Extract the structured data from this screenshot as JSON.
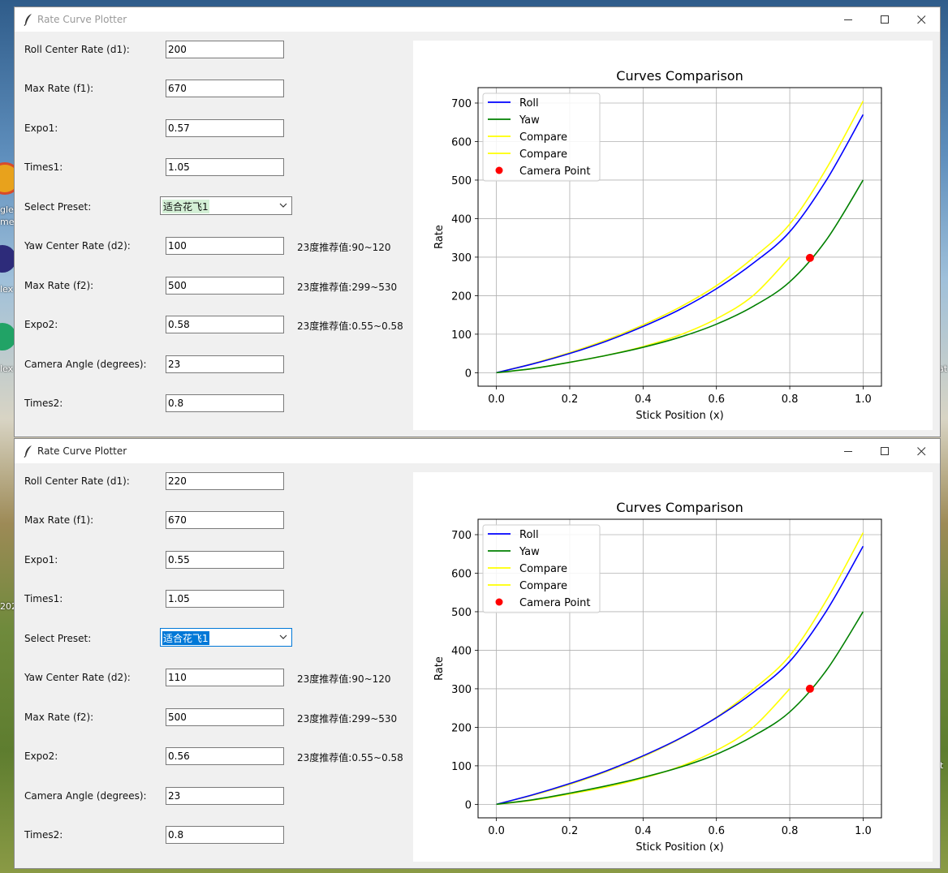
{
  "desktop": {
    "labels": [
      "gle",
      "me",
      "lex",
      "lex",
      "202",
      "at",
      "t"
    ]
  },
  "windows": [
    {
      "title": "Rate Curve Plotter",
      "fields": [
        {
          "label": "Roll Center Rate (d1):",
          "value": "200"
        },
        {
          "label": "Max Rate (f1):",
          "value": "670"
        },
        {
          "label": "Expo1:",
          "value": "0.57"
        },
        {
          "label": "Times1:",
          "value": "1.05"
        },
        {
          "label": "Select Preset:",
          "value": "适合花飞1"
        },
        {
          "label": "Yaw Center Rate (d2):",
          "value": "100",
          "hint": "23度推荐值:90~120"
        },
        {
          "label": "Max Rate (f2):",
          "value": "500",
          "hint": "23度推荐值:299~530"
        },
        {
          "label": "Expo2:",
          "value": "0.58",
          "hint": "23度推荐值:0.55~0.58"
        },
        {
          "label": "Camera Angle (degrees):",
          "value": "23"
        },
        {
          "label": "Times2:",
          "value": "0.8"
        }
      ],
      "chart_data": {
        "type": "line",
        "title": "Curves Comparison",
        "xlabel": "Stick Position (x)",
        "ylabel": "Rate",
        "xlim": [
          -0.05,
          1.05
        ],
        "ylim": [
          -35,
          740
        ],
        "xticks": [
          "0.0",
          "0.2",
          "0.4",
          "0.6",
          "0.8",
          "1.0"
        ],
        "yticks": [
          "0",
          "100",
          "200",
          "300",
          "400",
          "500",
          "600",
          "700"
        ],
        "grid": true,
        "legend_position": "top-left",
        "x": [
          0,
          0.1,
          0.2,
          0.3,
          0.4,
          0.5,
          0.6,
          0.7,
          0.8,
          0.9,
          1.0
        ],
        "series": [
          {
            "name": "Roll",
            "color": "#0000ff",
            "values": [
              0,
              23,
              50,
              82,
              120,
              164,
              218,
              284,
              366,
              500,
              670
            ]
          },
          {
            "name": "Yaw",
            "color": "#008000",
            "values": [
              0,
              11,
              27,
              45,
              66,
              92,
              126,
              172,
              236,
              345,
              500
            ]
          },
          {
            "name": "Compare",
            "color": "#ffff00",
            "values": [
              0,
              24,
              52,
              85,
              124,
              170,
              226,
              298,
              386,
              530,
              705
            ]
          },
          {
            "name": "Compare",
            "color": "#ffff00",
            "x": [
              0,
              0.1,
              0.2,
              0.3,
              0.4,
              0.5,
              0.6,
              0.7,
              0.8
            ],
            "values": [
              0,
              11,
              27,
              45,
              68,
              98,
              140,
              200,
              300
            ]
          }
        ],
        "points": [
          {
            "name": "Camera Point",
            "color": "#ff0000",
            "x": 0.855,
            "y": 298
          }
        ]
      }
    },
    {
      "title": "Rate Curve Plotter",
      "fields": [
        {
          "label": "Roll Center Rate (d1):",
          "value": "220"
        },
        {
          "label": "Max Rate (f1):",
          "value": "670"
        },
        {
          "label": "Expo1:",
          "value": "0.55"
        },
        {
          "label": "Times1:",
          "value": "1.05"
        },
        {
          "label": "Select Preset:",
          "value": "适合花飞1"
        },
        {
          "label": "Yaw Center Rate (d2):",
          "value": "110",
          "hint": "23度推荐值:90~120"
        },
        {
          "label": "Max Rate (f2):",
          "value": "500",
          "hint": "23度推荐值:299~530"
        },
        {
          "label": "Expo2:",
          "value": "0.56",
          "hint": "23度推荐值:0.55~0.58"
        },
        {
          "label": "Camera Angle (degrees):",
          "value": "23"
        },
        {
          "label": "Times2:",
          "value": "0.8"
        }
      ],
      "chart_data": {
        "type": "line",
        "title": "Curves Comparison",
        "xlabel": "Stick Position (x)",
        "ylabel": "Rate",
        "xlim": [
          -0.05,
          1.05
        ],
        "ylim": [
          -35,
          740
        ],
        "xticks": [
          "0.0",
          "0.2",
          "0.4",
          "0.6",
          "0.8",
          "1.0"
        ],
        "yticks": [
          "0",
          "100",
          "200",
          "300",
          "400",
          "500",
          "600",
          "700"
        ],
        "grid": true,
        "legend_position": "top-left",
        "x": [
          0,
          0.1,
          0.2,
          0.3,
          0.4,
          0.5,
          0.6,
          0.7,
          0.8,
          0.9,
          1.0
        ],
        "series": [
          {
            "name": "Roll",
            "color": "#0000ff",
            "values": [
              0,
              25,
              54,
              87,
              126,
              171,
              225,
              290,
              371,
              502,
              670
            ]
          },
          {
            "name": "Yaw",
            "color": "#008000",
            "values": [
              0,
              12,
              29,
              48,
              70,
              96,
              130,
              177,
              240,
              348,
              500
            ]
          },
          {
            "name": "Compare",
            "color": "#ffff00",
            "values": [
              0,
              24,
              52,
              85,
              124,
              170,
              226,
              298,
              386,
              530,
              705
            ]
          },
          {
            "name": "Compare",
            "color": "#ffff00",
            "x": [
              0,
              0.1,
              0.2,
              0.3,
              0.4,
              0.5,
              0.6,
              0.7,
              0.8
            ],
            "values": [
              0,
              11,
              27,
              45,
              68,
              98,
              140,
              200,
              300
            ]
          }
        ],
        "points": [
          {
            "name": "Camera Point",
            "color": "#ff0000",
            "x": 0.855,
            "y": 300
          }
        ]
      }
    }
  ]
}
